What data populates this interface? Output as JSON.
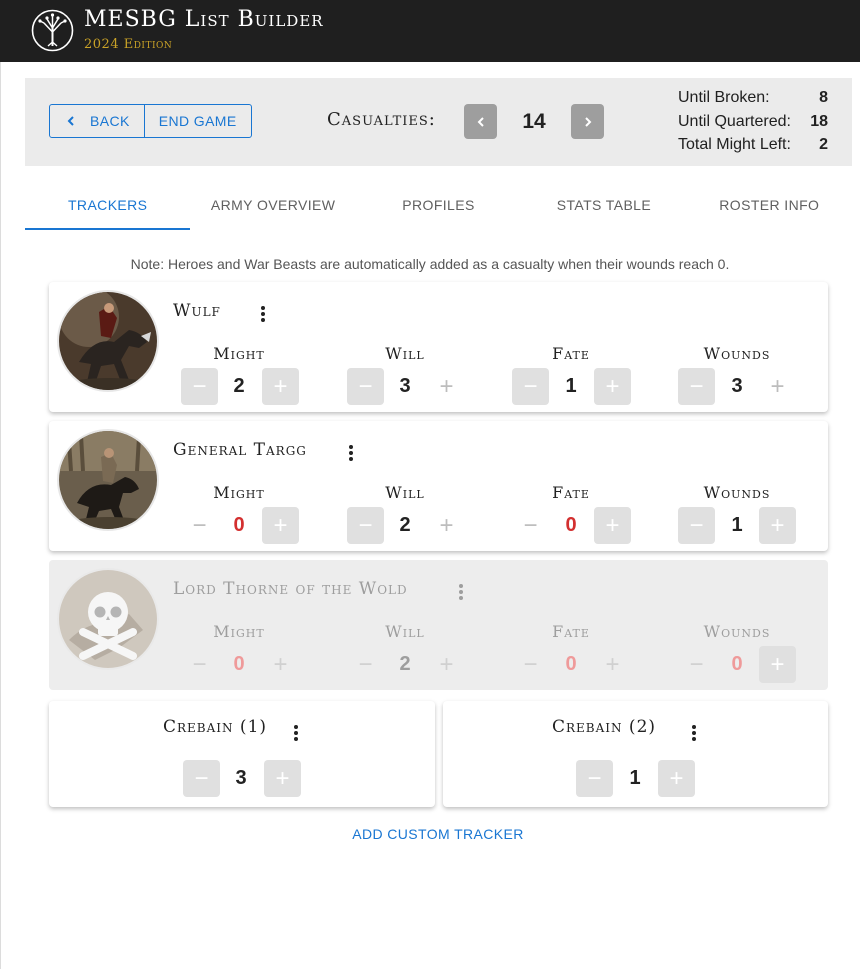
{
  "app": {
    "title": "MESBG List Builder",
    "subtitle": "2024 Edition",
    "logo_icon": "white-tree-icon"
  },
  "toolbar": {
    "back_label": "BACK",
    "end_game_label": "END GAME",
    "casualties_label": "Casualties:",
    "casualties_value": "14"
  },
  "stats": {
    "until_broken_label": "Until Broken:",
    "until_broken_value": "8",
    "until_quartered_label": "Until Quartered:",
    "until_quartered_value": "18",
    "might_left_label": "Total Might Left:",
    "might_left_value": "2"
  },
  "tabs": [
    {
      "label": "TRACKERS",
      "active": true
    },
    {
      "label": "ARMY OVERVIEW"
    },
    {
      "label": "PROFILES"
    },
    {
      "label": "STATS TABLE"
    },
    {
      "label": "ROSTER INFO"
    }
  ],
  "note": "Note: Heroes and War Beasts are automatically added as a casualty when their wounds reach 0.",
  "stat_labels": {
    "might": "Might",
    "will": "Will",
    "fate": "Fate",
    "wounds": "Wounds"
  },
  "heroes": [
    {
      "name": "Wulf",
      "might": "2",
      "will": "3",
      "fate": "1",
      "wounds": "3",
      "status": "alive"
    },
    {
      "name": "General Targg",
      "might": "0",
      "will": "2",
      "fate": "0",
      "wounds": "1",
      "status": "alive"
    },
    {
      "name": "Lord Thorne of the Wold",
      "might": "0",
      "will": "2",
      "fate": "0",
      "wounds": "0",
      "status": "casualty"
    }
  ],
  "trackers": [
    {
      "name": "Crebain (1)",
      "value": "3"
    },
    {
      "name": "Crebain (2)",
      "value": "1"
    }
  ],
  "add_custom_tracker_label": "ADD CUSTOM TRACKER",
  "colors": {
    "accent": "#1976d2",
    "appbar": "#1f1f1f",
    "gold": "#c9a227",
    "zero_value": "#d32f2f"
  }
}
